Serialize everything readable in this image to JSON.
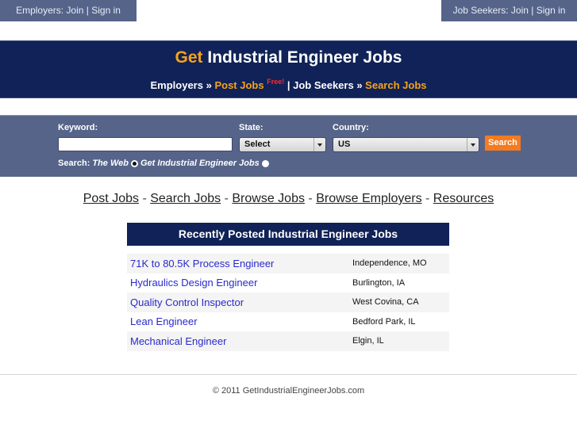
{
  "top_links": {
    "employers": "Employers: Join | Sign in",
    "job_seekers": "Job Seekers: Join | Sign in"
  },
  "banner": {
    "title_highlight": "Get",
    "title_rest": " Industrial Engineer Jobs",
    "subnav": {
      "employers": "Employers",
      "raquo": " » ",
      "post_jobs": "Post Jobs",
      "free": "Free!",
      "separator": " | ",
      "job_seekers": "Job Seekers",
      "search_jobs": "Search Jobs"
    }
  },
  "search": {
    "keyword_label": "Keyword:",
    "keyword_value": "",
    "state_label": "State:",
    "state_value": "Select",
    "country_label": "Country:",
    "country_value": "US",
    "button": "Search",
    "scope_label": "Search:",
    "scope_options": [
      {
        "label": "The Web",
        "checked": true
      },
      {
        "label": "Get Industrial Engineer Jobs",
        "checked": false
      }
    ]
  },
  "main_nav": {
    "items": [
      "Post Jobs",
      "Search Jobs",
      "Browse Jobs",
      "Browse Employers",
      "Resources"
    ],
    "separator": " - "
  },
  "jobs": {
    "header": "Recently Posted Industrial Engineer Jobs",
    "rows": [
      {
        "title": "71K to 80.5K Process Engineer",
        "location": "Independence, MO"
      },
      {
        "title": "Hydraulics Design Engineer",
        "location": "Burlington, IA"
      },
      {
        "title": "Quality Control Inspector",
        "location": "West Covina, CA"
      },
      {
        "title": "Lean Engineer",
        "location": "Bedford Park, IL"
      },
      {
        "title": "Mechanical Engineer",
        "location": "Elgin, IL"
      }
    ]
  },
  "footer": {
    "copyright": "© 2011 GetIndustrialEngineerJobs.com"
  },
  "colors": {
    "navy": "#102257",
    "slate": "#56648a",
    "orange": "#f7a21b",
    "button_orange": "#f47b20",
    "link_blue": "#2a2acc",
    "free_red": "#ff2a2a"
  }
}
